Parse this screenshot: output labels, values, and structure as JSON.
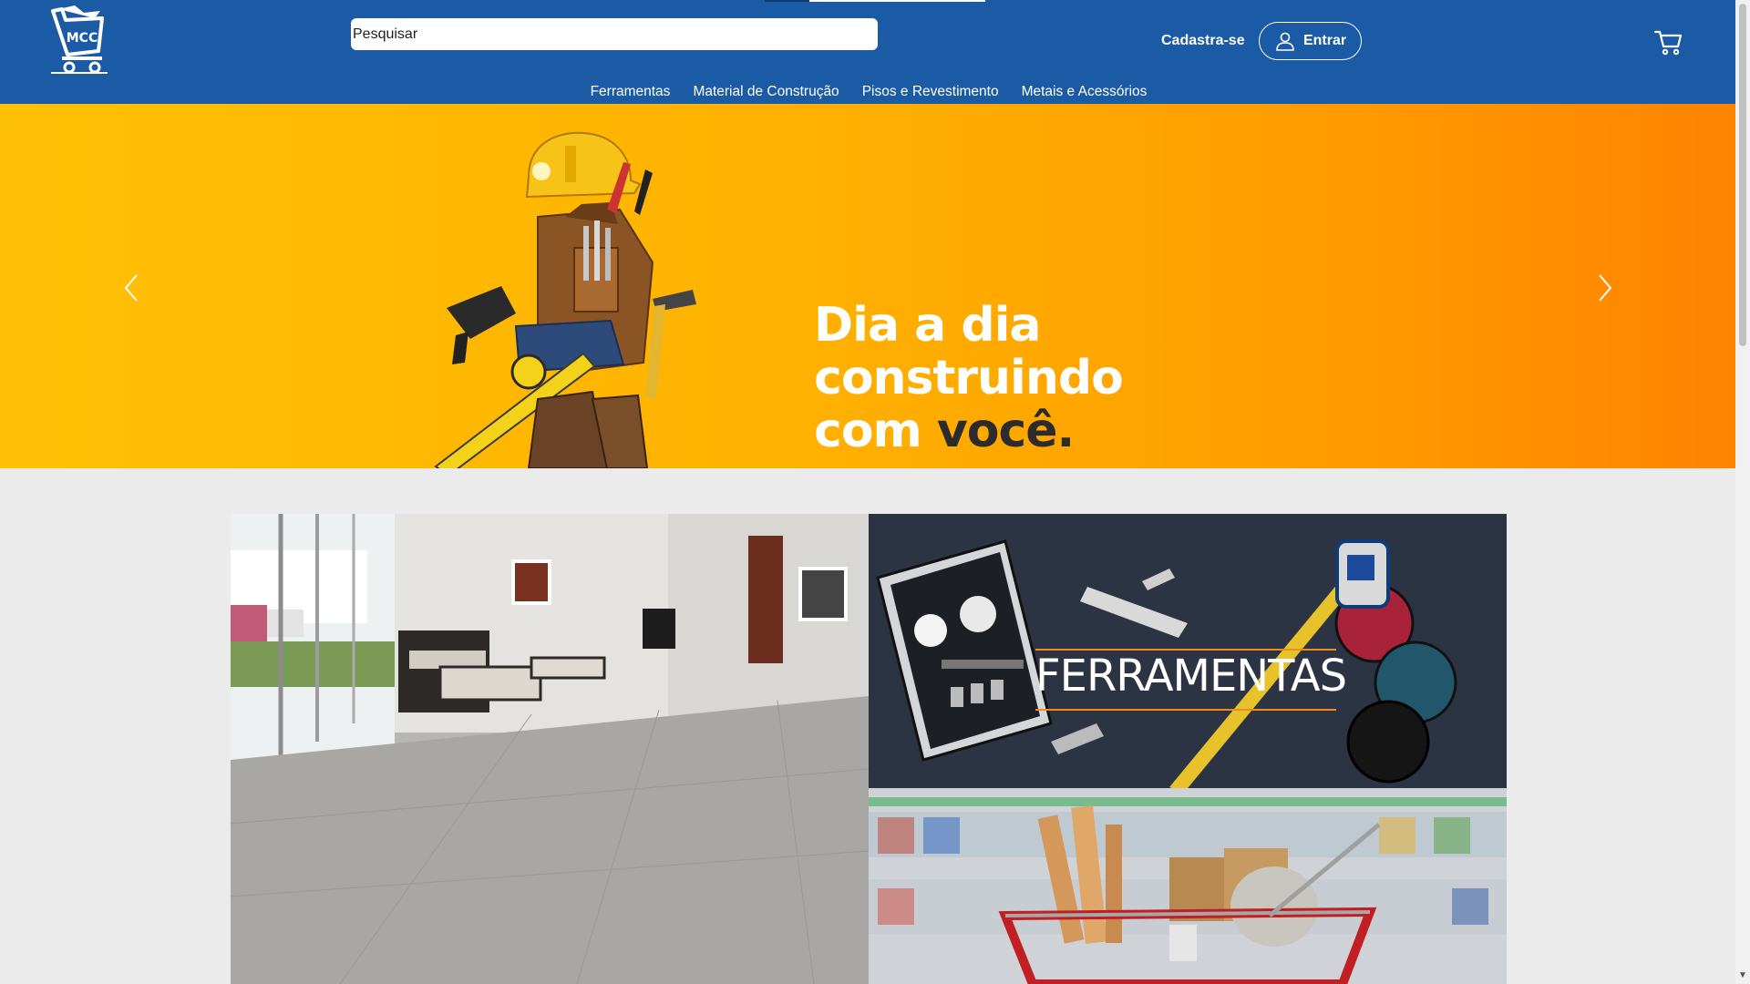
{
  "header": {
    "search_placeholder": "Pesquisar",
    "signup_label": "Cadastra-se",
    "login_label": "Entrar",
    "logo_text": "MCC"
  },
  "nav": {
    "items": [
      "Ferramentas",
      "Material de Construção",
      "Pisos e Revestimento",
      "Metais e Acessórios"
    ]
  },
  "hero": {
    "line1": "Dia a dia",
    "line2": "construindo",
    "line3_a": "com ",
    "line3_b": "você."
  },
  "categories": {
    "tools_label": "FERRAMENTAS"
  },
  "colors": {
    "header_bg": "#1b5aa5",
    "hero_start": "#ffc105",
    "hero_end": "#ff8300",
    "page_bg": "#ebebeb",
    "accent_line": "#f28b1e"
  },
  "icons": {
    "logo": "cart-logo-icon",
    "user": "user-icon",
    "cart": "cart-icon",
    "prev": "chevron-left-icon",
    "next": "chevron-right-icon"
  }
}
